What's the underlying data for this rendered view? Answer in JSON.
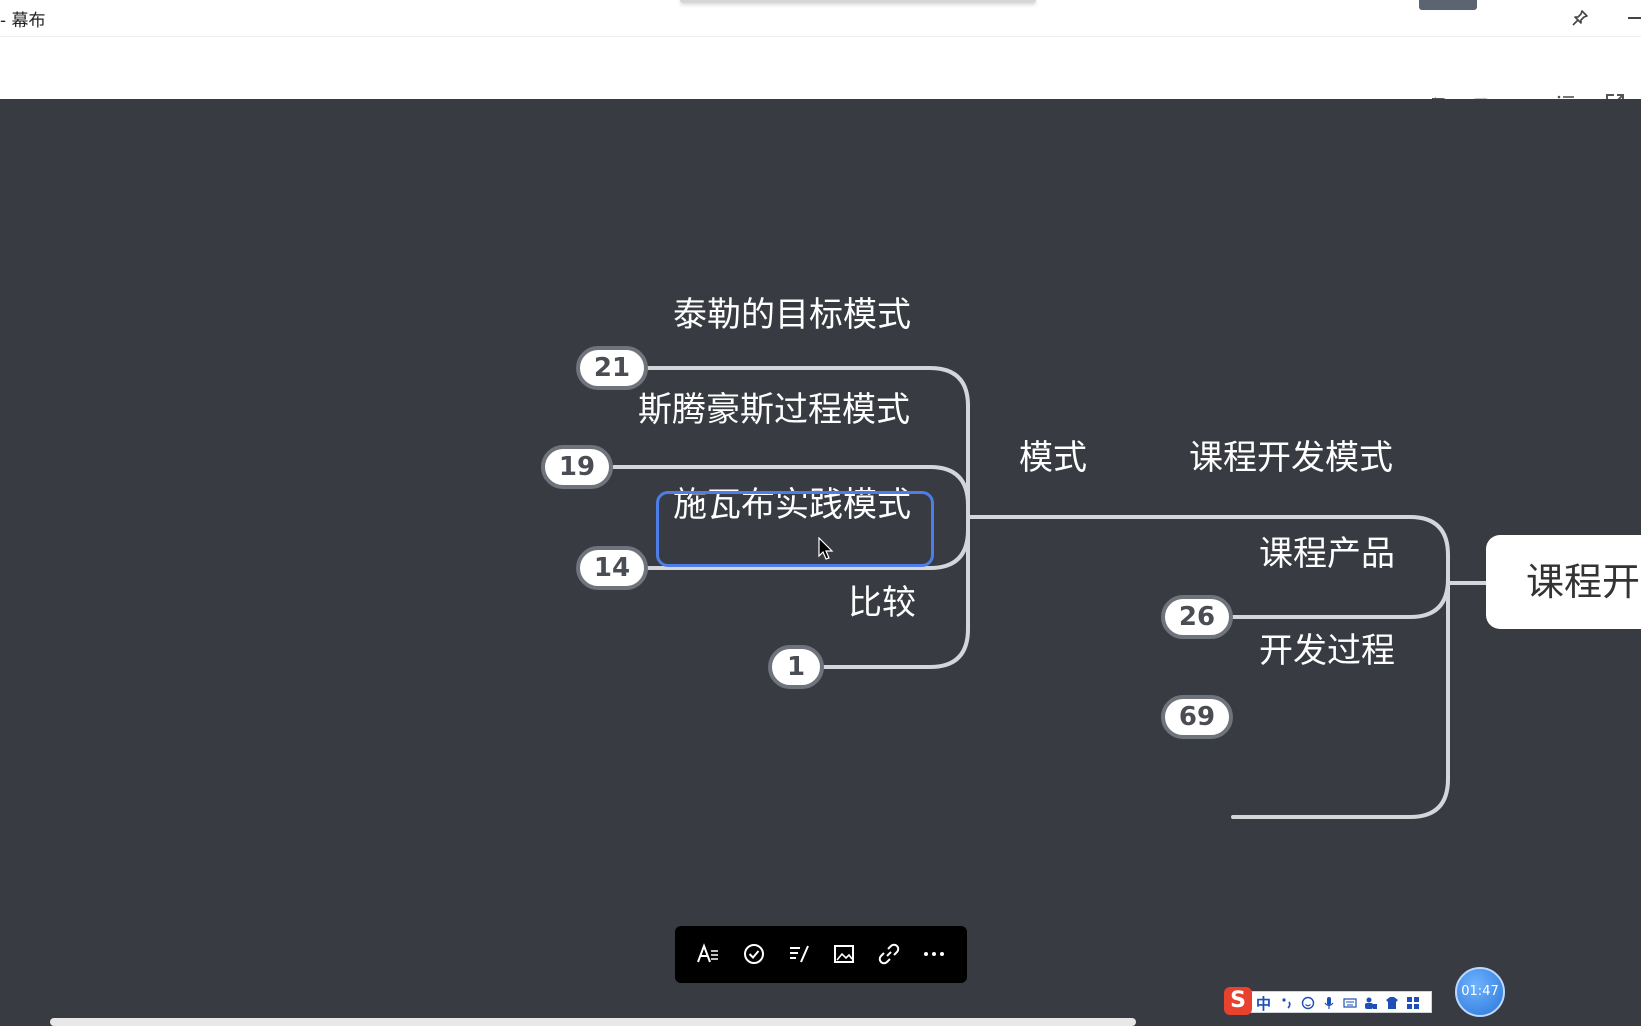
{
  "window": {
    "title": "- 幕布"
  },
  "toolbar": {
    "undo_icon": "undo-icon",
    "redo_icon": "redo-icon",
    "outline_icon": "list-icon",
    "export_icon": "open-external-icon"
  },
  "mindmap": {
    "root": {
      "label": "课程开"
    },
    "level1": [
      {
        "label": "课程开发模式"
      },
      {
        "label": "课程产品",
        "count": "26"
      },
      {
        "label": "开发过程",
        "count": "69"
      }
    ],
    "mode_node": {
      "label": "模式"
    },
    "children": [
      {
        "label": "泰勒的目标模式",
        "count": "21"
      },
      {
        "label": "斯腾豪斯过程模式",
        "count": "19"
      },
      {
        "label": "施瓦布实践模式",
        "count": "14"
      },
      {
        "label": "比较",
        "count": "1"
      }
    ]
  },
  "float_toolbar": {
    "items": [
      "text-style-icon",
      "check-icon",
      "note-icon",
      "image-icon",
      "link-icon",
      "more-icon"
    ]
  },
  "ime": {
    "logo": "S",
    "mode": "中"
  },
  "timer": {
    "value": "01:47"
  },
  "colors": {
    "canvas_bg": "#383b42",
    "selection": "#4d7de6",
    "badge_border": "#6f737b"
  }
}
